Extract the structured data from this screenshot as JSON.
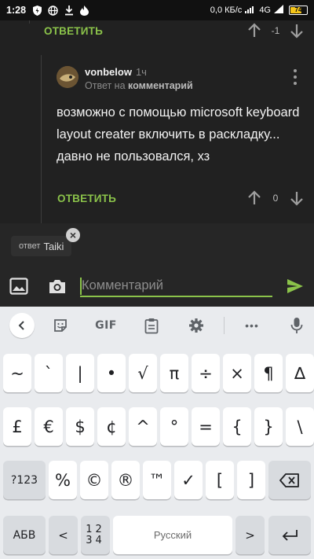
{
  "status_bar": {
    "time": "1:28",
    "net_speed": "0,0 КБ/с",
    "network": "4G",
    "battery": "74",
    "battery_level": 0.74
  },
  "comments": {
    "top_reply_label": "ОТВЕТИТЬ",
    "top_score": "-1",
    "comment": {
      "username": "vonbelow",
      "time_ago": "1ч",
      "reply_prefix": "Ответ на",
      "reply_target": "комментарий",
      "text": "возможно с помощью microsoft keyboard layout creater включить в раскладку... давно не пользовался, хз",
      "reply_label": "ОТВЕТИТЬ",
      "score": "0"
    }
  },
  "reply_chip": {
    "prefix": "ответ",
    "name": "Taiki"
  },
  "input": {
    "placeholder": "Комментарий",
    "accent": "#8bc34a"
  },
  "keyboard": {
    "toolbar": {
      "gif_label": "GIF",
      "more_label": "•••"
    },
    "row1": [
      "~",
      "`",
      "|",
      "•",
      "√",
      "π",
      "÷",
      "×",
      "¶",
      "∆"
    ],
    "row2": [
      "£",
      "€",
      "$",
      "¢",
      "^",
      "°",
      "=",
      "{",
      "}",
      "\\"
    ],
    "row3": {
      "mode_key": "?123",
      "keys": [
        "%",
        "©",
        "®",
        "™",
        "✓",
        "[",
        "]"
      ]
    },
    "row4": {
      "lang_key": "АБВ",
      "left": "<",
      "num_top": "12",
      "num_bottom": "34",
      "space_label": "Русский",
      "right": ">"
    }
  }
}
